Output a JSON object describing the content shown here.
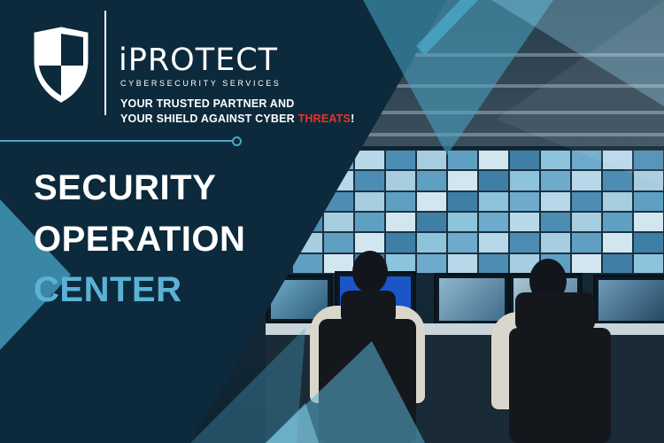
{
  "brand": {
    "name": "iPROTECT",
    "subtitle": "CYBERSECURITY SERVICES",
    "tagline_line1": "YOUR TRUSTED PARTNER AND",
    "tagline_line2_prefix": "YOUR SHIELD AGAINST CYBER ",
    "tagline_line2_accent": "THREATS",
    "tagline_line2_suffix": "!"
  },
  "headline": {
    "line1": "SECURITY",
    "line2": "OPERATION",
    "line3": "CENTER"
  },
  "colors": {
    "background": "#0c2a3c",
    "accent_blue": "#5ab3d5",
    "accent_red": "#e5342c",
    "text": "#ffffff"
  },
  "icons": {
    "logo": "shield-icon"
  }
}
